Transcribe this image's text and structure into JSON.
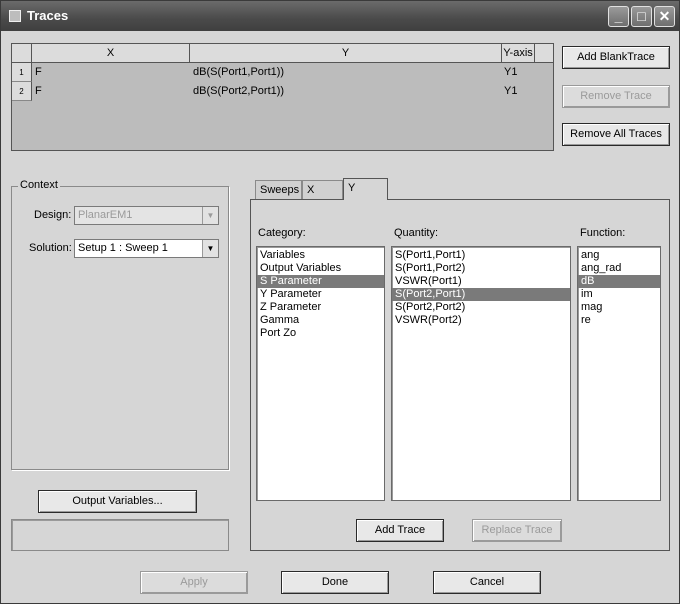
{
  "window": {
    "title": "Traces",
    "minimize": "_",
    "maximize": "□",
    "close": "✕"
  },
  "grid": {
    "headers": {
      "x": "X",
      "y": "Y",
      "yaxis": "Y-axis"
    },
    "rows": [
      {
        "num": "1",
        "x": "F",
        "y": "dB(S(Port1,Port1))",
        "axis": "Y1"
      },
      {
        "num": "2",
        "x": "F",
        "y": "dB(S(Port2,Port1))",
        "axis": "Y1"
      }
    ]
  },
  "buttons": {
    "add_blank": "Add BlankTrace",
    "remove_trace": "Remove Trace",
    "remove_all": "Remove All Traces",
    "output_variables": "Output Variables...",
    "add_trace": "Add Trace",
    "replace_trace": "Replace Trace",
    "apply": "Apply",
    "done": "Done",
    "cancel": "Cancel"
  },
  "context": {
    "label": "Context",
    "design_label": "Design:",
    "design_value": "PlanarEM1",
    "solution_label": "Solution:",
    "solution_value": "Setup 1 : Sweep 1"
  },
  "tabs": [
    "Sweeps",
    "X",
    "Y"
  ],
  "category": {
    "label": "Category:",
    "items": [
      "Variables",
      "Output Variables",
      "S Parameter",
      "Y Parameter",
      "Z Parameter",
      "Gamma",
      "Port Zo"
    ],
    "selected": 2
  },
  "quantity": {
    "label": "Quantity:",
    "items": [
      "S(Port1,Port1)",
      "S(Port1,Port2)",
      "VSWR(Port1)",
      "S(Port2,Port1)",
      "S(Port2,Port2)",
      "VSWR(Port2)"
    ],
    "selected": 3
  },
  "function": {
    "label": "Function:",
    "items": [
      "ang",
      "ang_rad",
      "dB",
      "im",
      "mag",
      "re"
    ],
    "selected": 2
  }
}
